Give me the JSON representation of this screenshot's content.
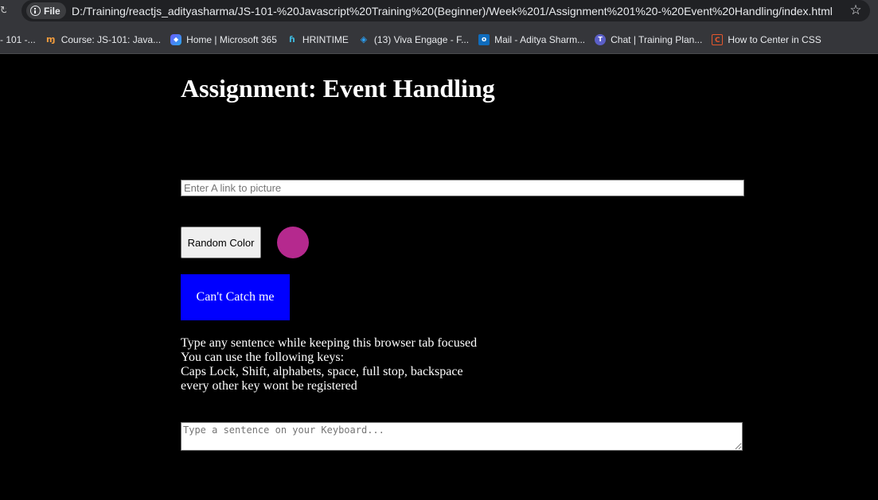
{
  "browser": {
    "site_chip_label": "File",
    "url": "D:/Training/reactjs_adityasharma/JS-101-%20Javascript%20Training%20(Beginner)/Week%201/Assignment%201%20-%20Event%20Handling/index.html",
    "bookmarks": [
      {
        "label": "- 101 -...",
        "icon": "none"
      },
      {
        "label": "Course: JS-101: Java...",
        "icon": "udemy-icon"
      },
      {
        "label": "Home | Microsoft 365",
        "icon": "microsoft-365-icon"
      },
      {
        "label": "HRINTIME",
        "icon": "hrintime-icon"
      },
      {
        "label": "(13) Viva Engage - F...",
        "icon": "viva-engage-icon"
      },
      {
        "label": "Mail - Aditya Sharm...",
        "icon": "outlook-icon"
      },
      {
        "label": "Chat | Training Plan...",
        "icon": "teams-icon"
      },
      {
        "label": "How to Center in CSS",
        "icon": "css-icon"
      }
    ]
  },
  "page": {
    "title": "Assignment: Event Handling",
    "picture_input": {
      "placeholder": "Enter A link to picture",
      "value": ""
    },
    "random_color_button": "Random Color",
    "circle_color": "#b5298e",
    "catch_button": "Can't Catch me",
    "instructions": [
      "Type any sentence while keeping this browser tab focused",
      "You can use the following keys:",
      "Caps Lock, Shift, alphabets, space, full stop, backspace",
      "every other key wont be registered"
    ],
    "sentence_box": {
      "placeholder": "Type a sentence on your Keyboard...",
      "value": ""
    }
  },
  "colors": {
    "page_background": "#000000",
    "catch_button_background": "#0000ff",
    "browser_chrome": "#35363a"
  }
}
